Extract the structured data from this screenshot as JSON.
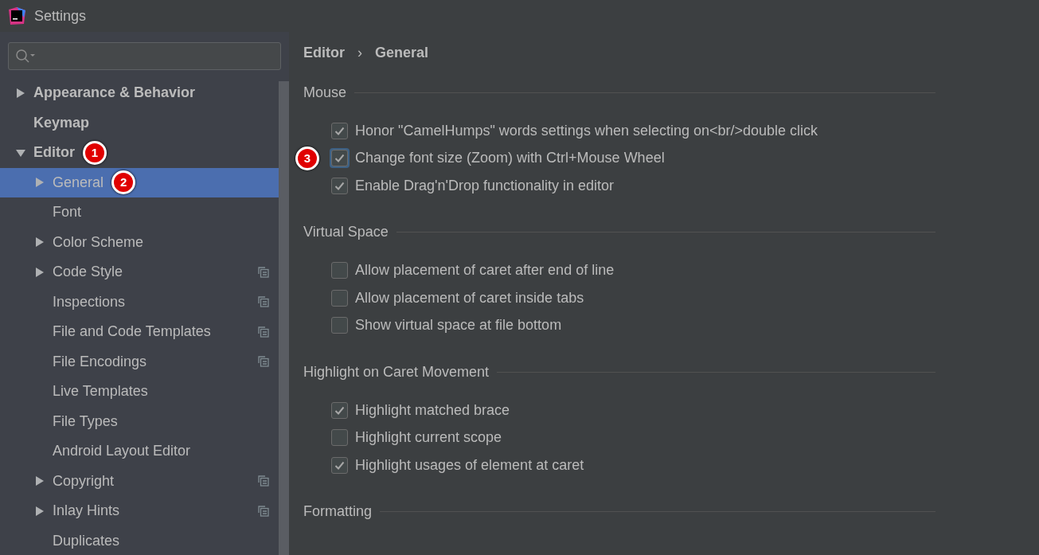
{
  "window": {
    "title": "Settings"
  },
  "sidebar": {
    "items": [
      {
        "label": "Appearance & Behavior",
        "expanded": false,
        "selected": false
      },
      {
        "label": "Keymap",
        "selected": false
      },
      {
        "label": "Editor",
        "expanded": true,
        "selected": false,
        "badge": "1",
        "children": [
          {
            "label": "General",
            "expanded": false,
            "selected": true,
            "badge": "2"
          },
          {
            "label": "Font",
            "selected": false
          },
          {
            "label": "Color Scheme",
            "expanded": false,
            "selected": false
          },
          {
            "label": "Code Style",
            "expanded": false,
            "selected": false,
            "project_scope": true
          },
          {
            "label": "Inspections",
            "selected": false,
            "project_scope": true
          },
          {
            "label": "File and Code Templates",
            "selected": false,
            "project_scope": true
          },
          {
            "label": "File Encodings",
            "selected": false,
            "project_scope": true
          },
          {
            "label": "Live Templates",
            "selected": false
          },
          {
            "label": "File Types",
            "selected": false
          },
          {
            "label": "Android Layout Editor",
            "selected": false
          },
          {
            "label": "Copyright",
            "expanded": false,
            "selected": false,
            "project_scope": true
          },
          {
            "label": "Inlay Hints",
            "expanded": false,
            "selected": false,
            "project_scope": true
          },
          {
            "label": "Duplicates",
            "selected": false
          }
        ]
      }
    ]
  },
  "breadcrumb": [
    "Editor",
    "›",
    "General"
  ],
  "sections": [
    {
      "title": "Mouse",
      "options": [
        {
          "label": "Honor \"CamelHumps\" words settings when selecting on<br/>double click",
          "checked": true,
          "focused": false
        },
        {
          "label": "Change font size (Zoom) with Ctrl+Mouse Wheel",
          "checked": true,
          "focused": true,
          "badge": "3"
        },
        {
          "label": "Enable Drag'n'Drop functionality in editor",
          "checked": true,
          "focused": false
        }
      ]
    },
    {
      "title": "Virtual Space",
      "options": [
        {
          "label": "Allow placement of caret after end of line",
          "checked": false,
          "focused": false
        },
        {
          "label": "Allow placement of caret inside tabs",
          "checked": false,
          "focused": false
        },
        {
          "label": "Show virtual space at file bottom",
          "checked": false,
          "focused": false
        }
      ]
    },
    {
      "title": "Highlight on Caret Movement",
      "options": [
        {
          "label": "Highlight matched brace",
          "checked": true,
          "focused": false
        },
        {
          "label": "Highlight current scope",
          "checked": false,
          "focused": false
        },
        {
          "label": "Highlight usages of element at caret",
          "checked": true,
          "focused": false
        }
      ]
    },
    {
      "title": "Formatting"
    }
  ]
}
